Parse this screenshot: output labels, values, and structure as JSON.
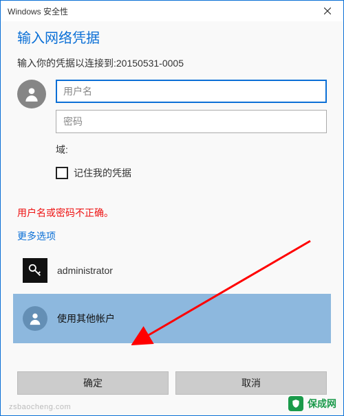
{
  "titlebar": {
    "title": "Windows 安全性"
  },
  "dialog": {
    "heading": "输入网络凭据",
    "instruction": "输入你的凭据以连接到:20150531-0005",
    "username_placeholder": "用户名",
    "password_placeholder": "密码",
    "domain_label": "域:",
    "remember_label": "记住我的凭据",
    "error_text": "用户名或密码不正确。",
    "more_options": "更多选项"
  },
  "accounts": {
    "admin_label": "administrator",
    "other_label": "使用其他帐户"
  },
  "buttons": {
    "ok": "确定",
    "cancel": "取消"
  },
  "brand": {
    "name": "保成网",
    "url": "zsbaocheng.com"
  },
  "colors": {
    "accent": "#0a6fd6",
    "selected": "#8db8de",
    "error": "#e11",
    "brand": "#1a9a4a"
  }
}
